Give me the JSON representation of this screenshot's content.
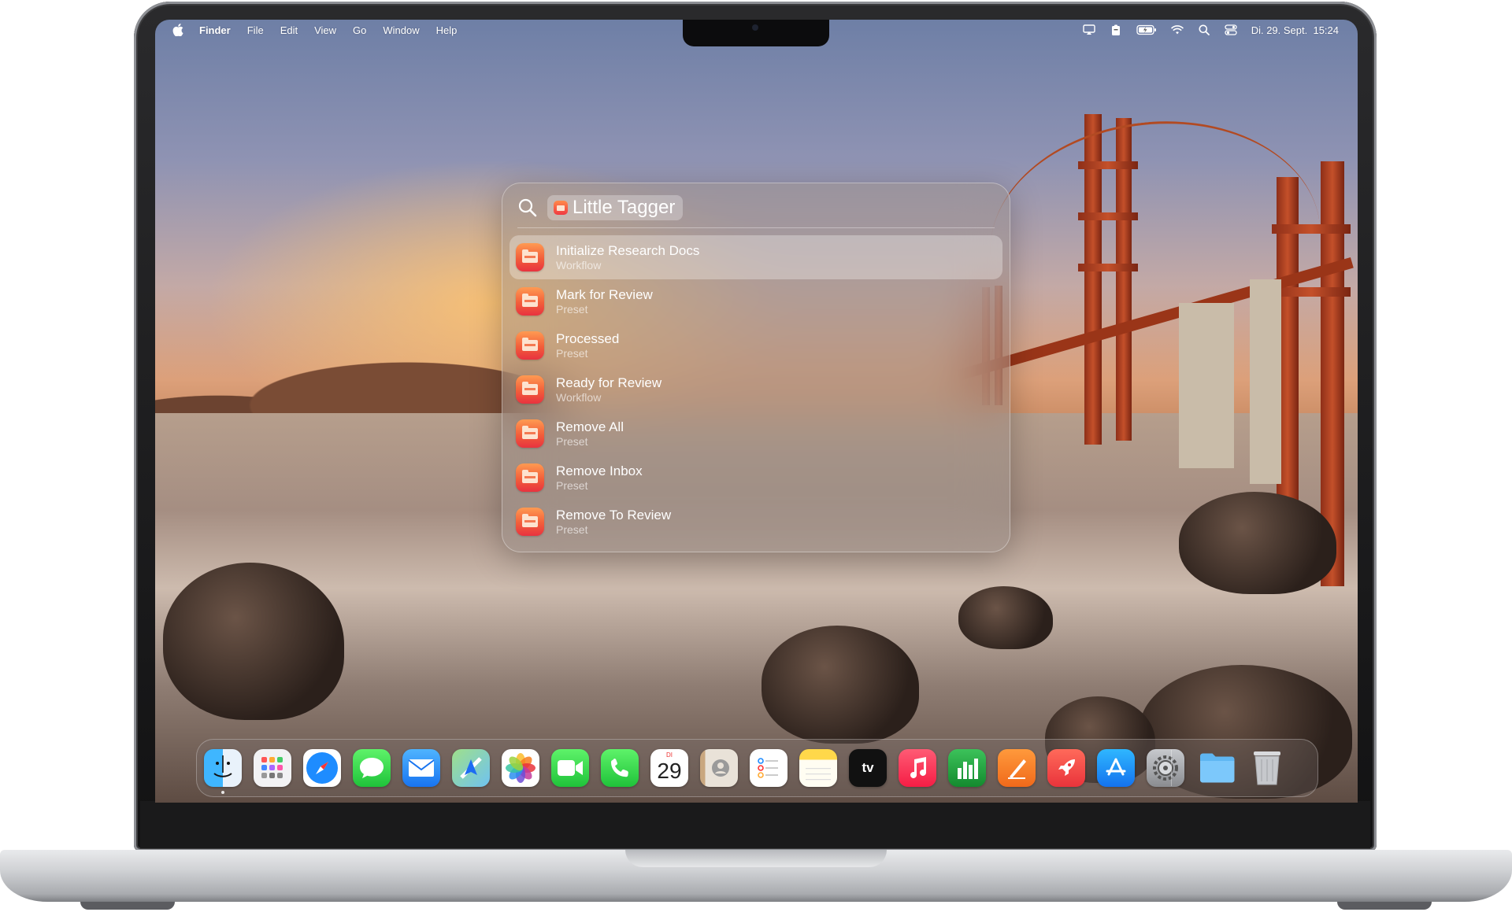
{
  "menubar": {
    "app_name": "Finder",
    "menus": [
      "File",
      "Edit",
      "View",
      "Go",
      "Window",
      "Help"
    ],
    "clock": "Di. 29. Sept.  15:24",
    "status_icons": [
      "screen-mirroring-icon",
      "clipboard-icon",
      "battery-icon",
      "wifi-icon",
      "search-icon",
      "control-center-icon"
    ]
  },
  "spotlight": {
    "query_token": "Little Tagger",
    "results": [
      {
        "title": "Initialize Research Docs",
        "subtitle": "Workflow",
        "selected": true
      },
      {
        "title": "Mark for Review",
        "subtitle": "Preset",
        "selected": false
      },
      {
        "title": "Processed",
        "subtitle": "Preset",
        "selected": false
      },
      {
        "title": "Ready for Review",
        "subtitle": "Workflow",
        "selected": false
      },
      {
        "title": "Remove All",
        "subtitle": "Preset",
        "selected": false
      },
      {
        "title": "Remove Inbox",
        "subtitle": "Preset",
        "selected": false
      },
      {
        "title": "Remove To Review",
        "subtitle": "Preset",
        "selected": false
      }
    ]
  },
  "dock": {
    "apps": [
      "finder",
      "launchpad",
      "safari",
      "messages",
      "mail",
      "maps",
      "photos",
      "facetime",
      "phone",
      "calendar",
      "contacts",
      "reminders",
      "notes",
      "tv",
      "music",
      "numbers",
      "pages",
      "rocket",
      "app-store",
      "system-settings",
      "folder",
      "trash"
    ],
    "calendar": {
      "day_label": "DI",
      "date": "29"
    },
    "tv_label": "tv"
  },
  "colors": {
    "accent_icon_top": "#ff9a52",
    "accent_icon_bottom": "#e8323f"
  }
}
